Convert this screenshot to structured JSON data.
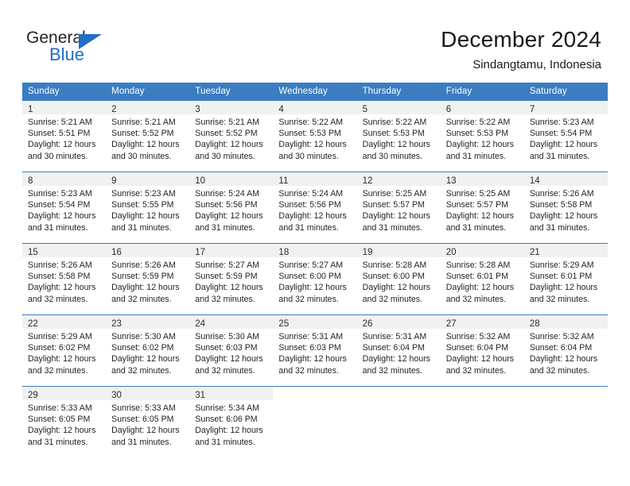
{
  "logo": {
    "word_top": "General",
    "word_bottom": "Blue",
    "triangle_color": "#1f6fc4"
  },
  "header": {
    "title": "December 2024",
    "subtitle": "Sindangtamu, Indonesia"
  },
  "theme": {
    "header_blue": "#3b7dc0",
    "band_gray": "#f1f1f1",
    "text": "#231f20"
  },
  "weekday_headers": [
    "Sunday",
    "Monday",
    "Tuesday",
    "Wednesday",
    "Thursday",
    "Friday",
    "Saturday"
  ],
  "weeks": [
    [
      {
        "day": "1",
        "sunrise": "Sunrise: 5:21 AM",
        "sunset": "Sunset: 5:51 PM",
        "daylight1": "Daylight: 12 hours",
        "daylight2": "and 30 minutes."
      },
      {
        "day": "2",
        "sunrise": "Sunrise: 5:21 AM",
        "sunset": "Sunset: 5:52 PM",
        "daylight1": "Daylight: 12 hours",
        "daylight2": "and 30 minutes."
      },
      {
        "day": "3",
        "sunrise": "Sunrise: 5:21 AM",
        "sunset": "Sunset: 5:52 PM",
        "daylight1": "Daylight: 12 hours",
        "daylight2": "and 30 minutes."
      },
      {
        "day": "4",
        "sunrise": "Sunrise: 5:22 AM",
        "sunset": "Sunset: 5:53 PM",
        "daylight1": "Daylight: 12 hours",
        "daylight2": "and 30 minutes."
      },
      {
        "day": "5",
        "sunrise": "Sunrise: 5:22 AM",
        "sunset": "Sunset: 5:53 PM",
        "daylight1": "Daylight: 12 hours",
        "daylight2": "and 30 minutes."
      },
      {
        "day": "6",
        "sunrise": "Sunrise: 5:22 AM",
        "sunset": "Sunset: 5:53 PM",
        "daylight1": "Daylight: 12 hours",
        "daylight2": "and 31 minutes."
      },
      {
        "day": "7",
        "sunrise": "Sunrise: 5:23 AM",
        "sunset": "Sunset: 5:54 PM",
        "daylight1": "Daylight: 12 hours",
        "daylight2": "and 31 minutes."
      }
    ],
    [
      {
        "day": "8",
        "sunrise": "Sunrise: 5:23 AM",
        "sunset": "Sunset: 5:54 PM",
        "daylight1": "Daylight: 12 hours",
        "daylight2": "and 31 minutes."
      },
      {
        "day": "9",
        "sunrise": "Sunrise: 5:23 AM",
        "sunset": "Sunset: 5:55 PM",
        "daylight1": "Daylight: 12 hours",
        "daylight2": "and 31 minutes."
      },
      {
        "day": "10",
        "sunrise": "Sunrise: 5:24 AM",
        "sunset": "Sunset: 5:56 PM",
        "daylight1": "Daylight: 12 hours",
        "daylight2": "and 31 minutes."
      },
      {
        "day": "11",
        "sunrise": "Sunrise: 5:24 AM",
        "sunset": "Sunset: 5:56 PM",
        "daylight1": "Daylight: 12 hours",
        "daylight2": "and 31 minutes."
      },
      {
        "day": "12",
        "sunrise": "Sunrise: 5:25 AM",
        "sunset": "Sunset: 5:57 PM",
        "daylight1": "Daylight: 12 hours",
        "daylight2": "and 31 minutes."
      },
      {
        "day": "13",
        "sunrise": "Sunrise: 5:25 AM",
        "sunset": "Sunset: 5:57 PM",
        "daylight1": "Daylight: 12 hours",
        "daylight2": "and 31 minutes."
      },
      {
        "day": "14",
        "sunrise": "Sunrise: 5:26 AM",
        "sunset": "Sunset: 5:58 PM",
        "daylight1": "Daylight: 12 hours",
        "daylight2": "and 31 minutes."
      }
    ],
    [
      {
        "day": "15",
        "sunrise": "Sunrise: 5:26 AM",
        "sunset": "Sunset: 5:58 PM",
        "daylight1": "Daylight: 12 hours",
        "daylight2": "and 32 minutes."
      },
      {
        "day": "16",
        "sunrise": "Sunrise: 5:26 AM",
        "sunset": "Sunset: 5:59 PM",
        "daylight1": "Daylight: 12 hours",
        "daylight2": "and 32 minutes."
      },
      {
        "day": "17",
        "sunrise": "Sunrise: 5:27 AM",
        "sunset": "Sunset: 5:59 PM",
        "daylight1": "Daylight: 12 hours",
        "daylight2": "and 32 minutes."
      },
      {
        "day": "18",
        "sunrise": "Sunrise: 5:27 AM",
        "sunset": "Sunset: 6:00 PM",
        "daylight1": "Daylight: 12 hours",
        "daylight2": "and 32 minutes."
      },
      {
        "day": "19",
        "sunrise": "Sunrise: 5:28 AM",
        "sunset": "Sunset: 6:00 PM",
        "daylight1": "Daylight: 12 hours",
        "daylight2": "and 32 minutes."
      },
      {
        "day": "20",
        "sunrise": "Sunrise: 5:28 AM",
        "sunset": "Sunset: 6:01 PM",
        "daylight1": "Daylight: 12 hours",
        "daylight2": "and 32 minutes."
      },
      {
        "day": "21",
        "sunrise": "Sunrise: 5:29 AM",
        "sunset": "Sunset: 6:01 PM",
        "daylight1": "Daylight: 12 hours",
        "daylight2": "and 32 minutes."
      }
    ],
    [
      {
        "day": "22",
        "sunrise": "Sunrise: 5:29 AM",
        "sunset": "Sunset: 6:02 PM",
        "daylight1": "Daylight: 12 hours",
        "daylight2": "and 32 minutes."
      },
      {
        "day": "23",
        "sunrise": "Sunrise: 5:30 AM",
        "sunset": "Sunset: 6:02 PM",
        "daylight1": "Daylight: 12 hours",
        "daylight2": "and 32 minutes."
      },
      {
        "day": "24",
        "sunrise": "Sunrise: 5:30 AM",
        "sunset": "Sunset: 6:03 PM",
        "daylight1": "Daylight: 12 hours",
        "daylight2": "and 32 minutes."
      },
      {
        "day": "25",
        "sunrise": "Sunrise: 5:31 AM",
        "sunset": "Sunset: 6:03 PM",
        "daylight1": "Daylight: 12 hours",
        "daylight2": "and 32 minutes."
      },
      {
        "day": "26",
        "sunrise": "Sunrise: 5:31 AM",
        "sunset": "Sunset: 6:04 PM",
        "daylight1": "Daylight: 12 hours",
        "daylight2": "and 32 minutes."
      },
      {
        "day": "27",
        "sunrise": "Sunrise: 5:32 AM",
        "sunset": "Sunset: 6:04 PM",
        "daylight1": "Daylight: 12 hours",
        "daylight2": "and 32 minutes."
      },
      {
        "day": "28",
        "sunrise": "Sunrise: 5:32 AM",
        "sunset": "Sunset: 6:04 PM",
        "daylight1": "Daylight: 12 hours",
        "daylight2": "and 32 minutes."
      }
    ],
    [
      {
        "day": "29",
        "sunrise": "Sunrise: 5:33 AM",
        "sunset": "Sunset: 6:05 PM",
        "daylight1": "Daylight: 12 hours",
        "daylight2": "and 31 minutes."
      },
      {
        "day": "30",
        "sunrise": "Sunrise: 5:33 AM",
        "sunset": "Sunset: 6:05 PM",
        "daylight1": "Daylight: 12 hours",
        "daylight2": "and 31 minutes."
      },
      {
        "day": "31",
        "sunrise": "Sunrise: 5:34 AM",
        "sunset": "Sunset: 6:06 PM",
        "daylight1": "Daylight: 12 hours",
        "daylight2": "and 31 minutes."
      },
      null,
      null,
      null,
      null
    ]
  ]
}
